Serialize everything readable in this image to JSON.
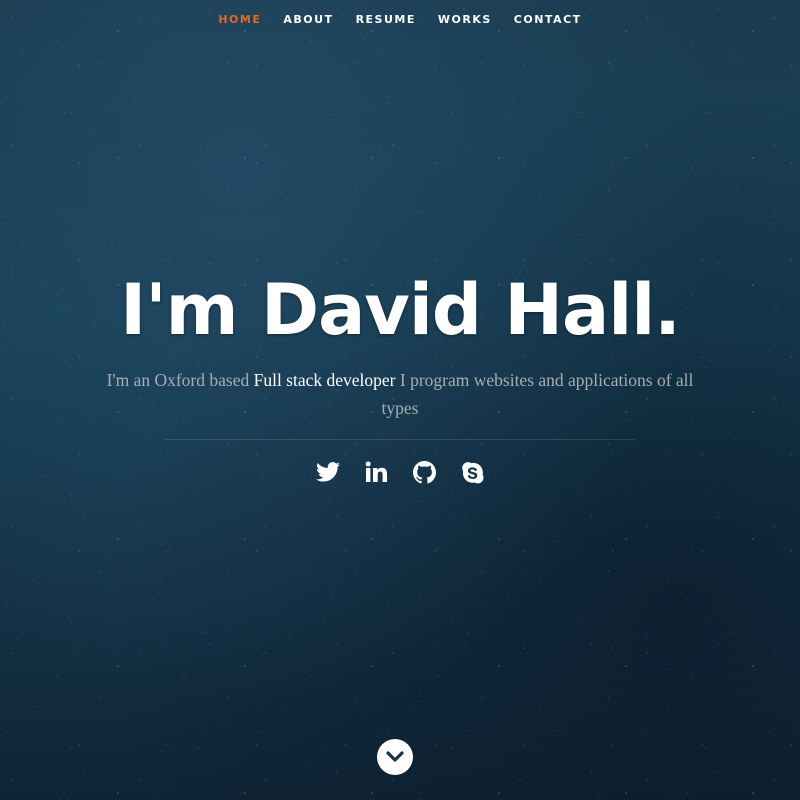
{
  "nav": {
    "items": [
      {
        "label": "HOME",
        "active": true
      },
      {
        "label": "ABOUT",
        "active": false
      },
      {
        "label": "RESUME",
        "active": false
      },
      {
        "label": "WORKS",
        "active": false
      },
      {
        "label": "CONTACT",
        "active": false
      }
    ],
    "active_color": "#e06a25"
  },
  "banner": {
    "headline": "I'm David Hall.",
    "intro_before": "I'm an Oxford based ",
    "intro_emphasis": "Full stack developer",
    "intro_after": " I program websites and applications of all types"
  },
  "social": {
    "icons": [
      "twitter-icon",
      "linkedin-icon",
      "github-icon",
      "skype-icon"
    ]
  },
  "scrolldown": {
    "icon": "chevron-down-icon"
  }
}
